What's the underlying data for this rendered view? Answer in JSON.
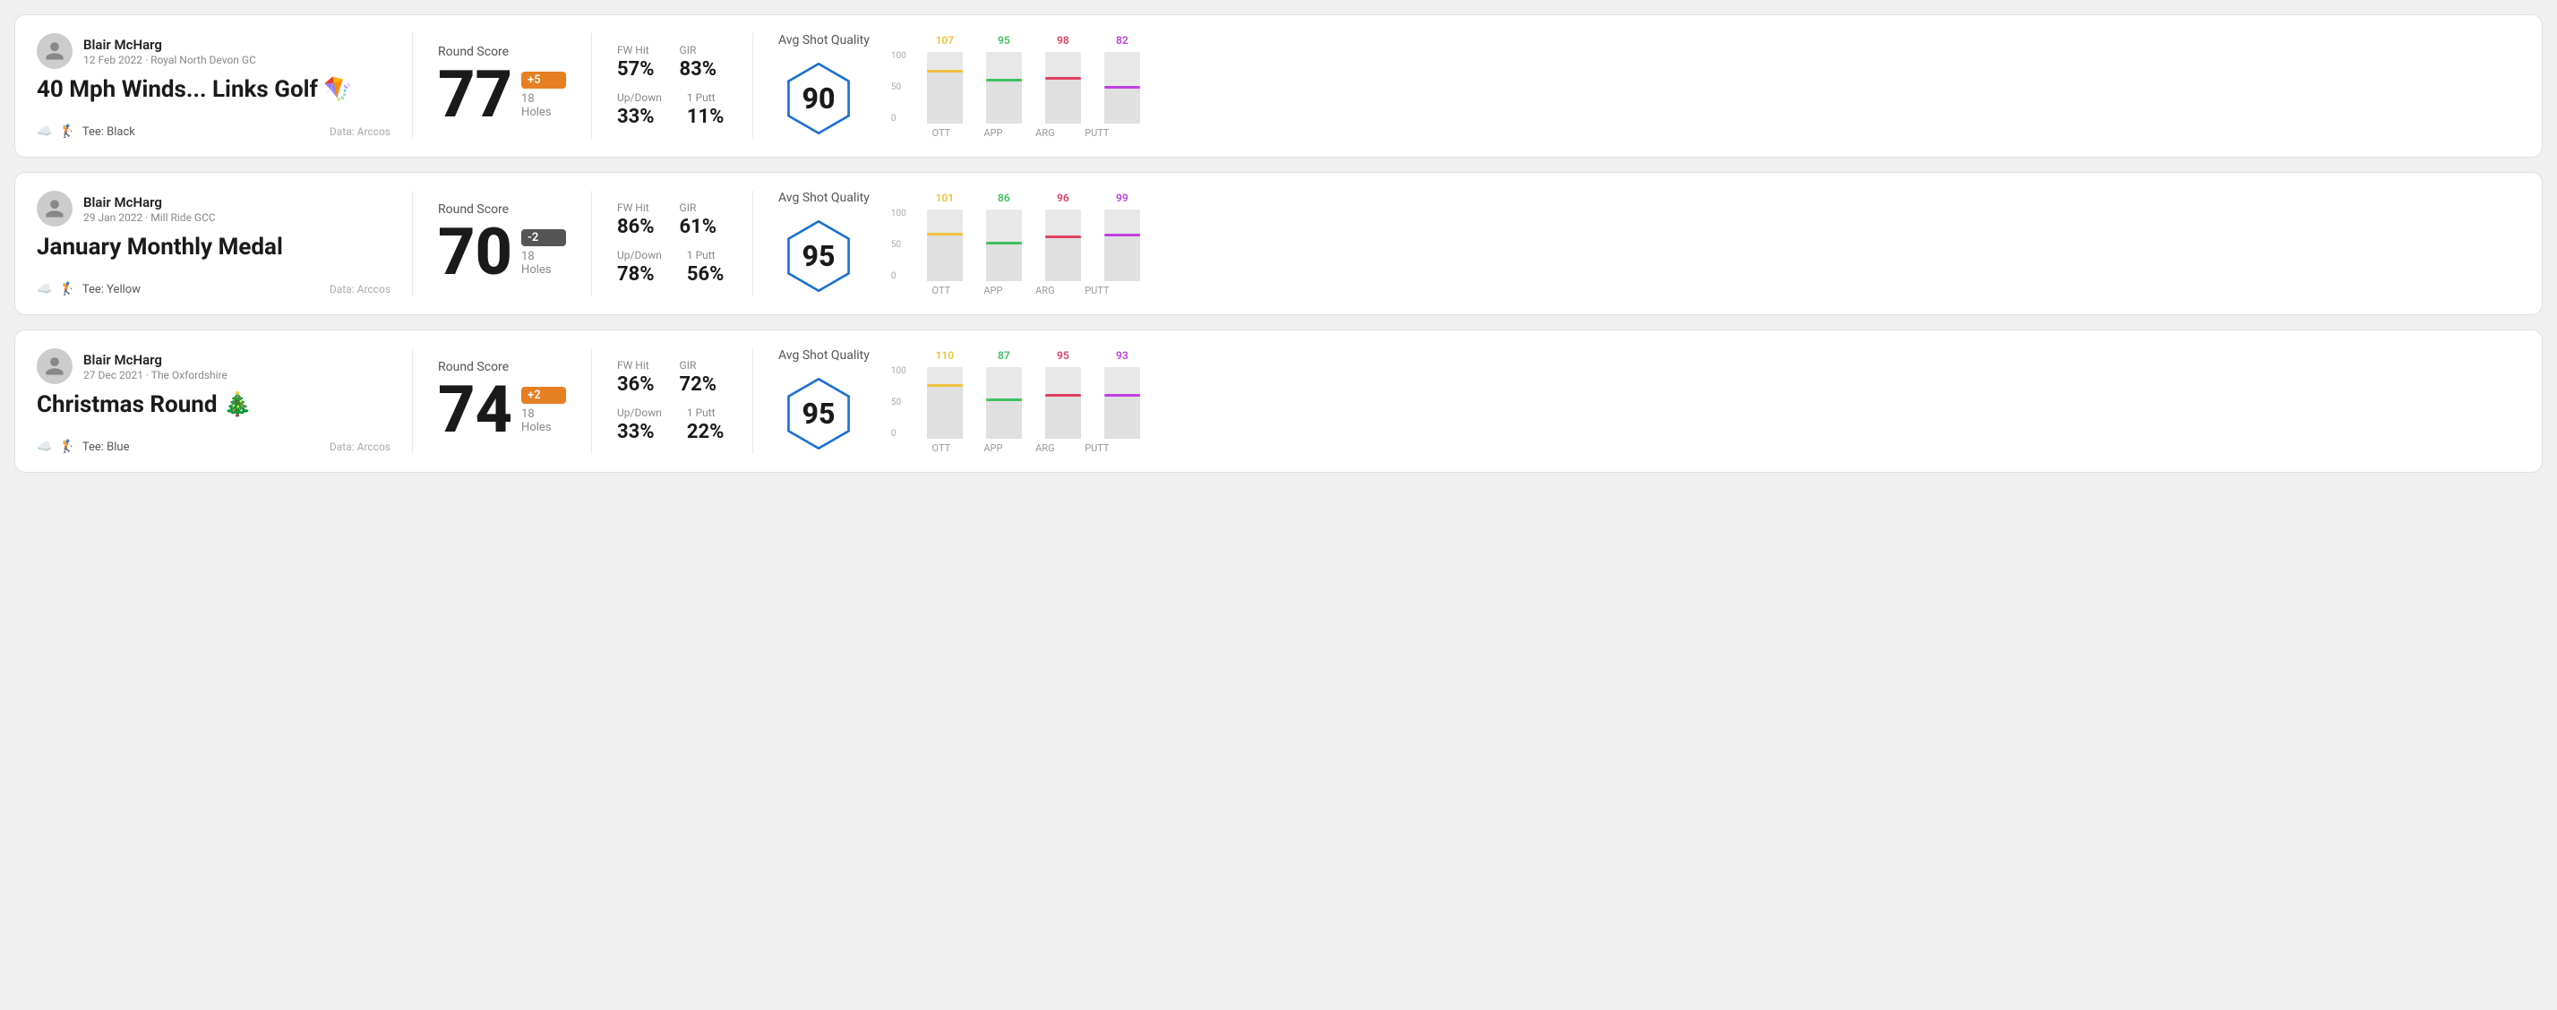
{
  "rounds": [
    {
      "id": "round-1",
      "user": {
        "name": "Blair McHarg",
        "date_course": "12 Feb 2022 · Royal North Devon GC"
      },
      "title": "40 Mph Winds... Links Golf 🪁",
      "tee": "Black",
      "data_source": "Data: Arccos",
      "score": {
        "label": "Round Score",
        "number": "77",
        "badge": "+5",
        "badge_type": "positive",
        "holes": "18 Holes"
      },
      "stats": {
        "fw_hit_label": "FW Hit",
        "fw_hit_value": "57%",
        "gir_label": "GIR",
        "gir_value": "83%",
        "updown_label": "Up/Down",
        "updown_value": "33%",
        "oneputt_label": "1 Putt",
        "oneputt_value": "11%"
      },
      "quality": {
        "label": "Avg Shot Quality",
        "score": "90",
        "bars": [
          {
            "label": "OTT",
            "value": 107,
            "color": "#f0c040",
            "height_pct": 75
          },
          {
            "label": "APP",
            "value": 95,
            "color": "#40c060",
            "height_pct": 62
          },
          {
            "label": "ARG",
            "value": 98,
            "color": "#e04060",
            "height_pct": 65
          },
          {
            "label": "PUTT",
            "value": 82,
            "color": "#c040e0",
            "height_pct": 52
          }
        ],
        "y_labels": [
          "100",
          "50",
          "0"
        ]
      }
    },
    {
      "id": "round-2",
      "user": {
        "name": "Blair McHarg",
        "date_course": "29 Jan 2022 · Mill Ride GCC"
      },
      "title": "January Monthly Medal",
      "tee": "Yellow",
      "data_source": "Data: Arccos",
      "score": {
        "label": "Round Score",
        "number": "70",
        "badge": "-2",
        "badge_type": "negative",
        "holes": "18 Holes"
      },
      "stats": {
        "fw_hit_label": "FW Hit",
        "fw_hit_value": "86%",
        "gir_label": "GIR",
        "gir_value": "61%",
        "updown_label": "Up/Down",
        "updown_value": "78%",
        "oneputt_label": "1 Putt",
        "oneputt_value": "56%"
      },
      "quality": {
        "label": "Avg Shot Quality",
        "score": "95",
        "bars": [
          {
            "label": "OTT",
            "value": 101,
            "color": "#f0c040",
            "height_pct": 68
          },
          {
            "label": "APP",
            "value": 86,
            "color": "#40c060",
            "height_pct": 55
          },
          {
            "label": "ARG",
            "value": 96,
            "color": "#e04060",
            "height_pct": 64
          },
          {
            "label": "PUTT",
            "value": 99,
            "color": "#c040e0",
            "height_pct": 66
          }
        ],
        "y_labels": [
          "100",
          "50",
          "0"
        ]
      }
    },
    {
      "id": "round-3",
      "user": {
        "name": "Blair McHarg",
        "date_course": "27 Dec 2021 · The Oxfordshire"
      },
      "title": "Christmas Round 🎄",
      "tee": "Blue",
      "data_source": "Data: Arccos",
      "score": {
        "label": "Round Score",
        "number": "74",
        "badge": "+2",
        "badge_type": "positive",
        "holes": "18 Holes"
      },
      "stats": {
        "fw_hit_label": "FW Hit",
        "fw_hit_value": "36%",
        "gir_label": "GIR",
        "gir_value": "72%",
        "updown_label": "Up/Down",
        "updown_value": "33%",
        "oneputt_label": "1 Putt",
        "oneputt_value": "22%"
      },
      "quality": {
        "label": "Avg Shot Quality",
        "score": "95",
        "bars": [
          {
            "label": "OTT",
            "value": 110,
            "color": "#f0c040",
            "height_pct": 76
          },
          {
            "label": "APP",
            "value": 87,
            "color": "#40c060",
            "height_pct": 56
          },
          {
            "label": "ARG",
            "value": 95,
            "color": "#e04060",
            "height_pct": 63
          },
          {
            "label": "PUTT",
            "value": 93,
            "color": "#c040e0",
            "height_pct": 62
          }
        ],
        "y_labels": [
          "100",
          "50",
          "0"
        ]
      }
    }
  ]
}
